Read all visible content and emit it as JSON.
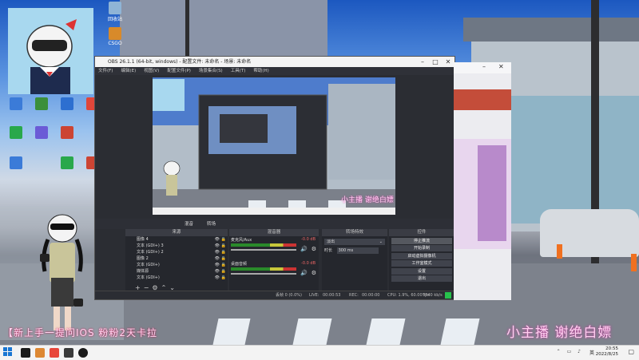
{
  "desktop": {
    "icons": [
      {
        "label": "回收站",
        "color": "#8fb4d6"
      },
      {
        "label": "CSGO",
        "color": "#d88a2a"
      },
      {
        "label": "",
        "color": "#3b7bd8"
      },
      {
        "label": "",
        "color": "#3b8f3b"
      },
      {
        "label": "",
        "color": "#2d6fd0"
      },
      {
        "label": "",
        "color": "#e0463a"
      },
      {
        "label": "",
        "color": "#29a84b"
      },
      {
        "label": "",
        "color": "#6b5bd6"
      },
      {
        "label": "",
        "color": "#c43"
      }
    ]
  },
  "obs": {
    "title": "OBS 26.1.1 (64-bit, windows) - 配置文件: 未命名 - 场景: 未命名",
    "menu": [
      "文件(F)",
      "编辑(E)",
      "视图(V)",
      "配置文件(P)",
      "场景集合(S)",
      "工具(T)",
      "帮助(H)"
    ],
    "mid_tabs": [
      "混音",
      "转场"
    ],
    "docks": {
      "sources": "来源",
      "mixer": "混音器",
      "transitions": "转场特效",
      "controls": "控件"
    },
    "sources": [
      "图像 4",
      "文本 (GDI+) 3",
      "文本 (GDI+) 2",
      "图像 2",
      "文本 (GDI+)",
      "媒体源",
      "文本 (GDI+)"
    ],
    "mixer": [
      {
        "name": "麦克风/Aux",
        "db": "-0.0 dB"
      },
      {
        "name": "桌面音频",
        "db": "-0.0 dB"
      }
    ],
    "transition": {
      "type": "淡出",
      "duration_label": "时长",
      "duration": "300 ms"
    },
    "controls": [
      "停止推流",
      "开始录制",
      "启动虚拟摄像机",
      "工作室模式",
      "设置",
      "退出"
    ],
    "status": {
      "dropped": "丢帧 0 (0.0%)",
      "live_label": "LIVE:",
      "live_time": "00:00:53",
      "rec_label": "REC:",
      "rec_time": "00:00:00",
      "cpu": "CPU: 1.9%, 60.00 fps",
      "kbps": "5340 kb/s",
      "indicator_color": "#27c24c"
    }
  },
  "overlay": {
    "left_text": "【新上手一提问IOS 粉粉2天卡拉",
    "right_text": "小主播 谢绝白嫖",
    "preview_text": "小主播 谢绝白嫖"
  },
  "taskbar": {
    "time": "20:55",
    "date": "2022/8/25",
    "lang": "英",
    "apps": [
      {
        "color": "#1a1a1a"
      },
      {
        "color": "#d83"
      },
      {
        "color": "#e8463a"
      },
      {
        "color": "#3a3a3a"
      },
      {
        "color": "#1a1a1a"
      }
    ]
  }
}
